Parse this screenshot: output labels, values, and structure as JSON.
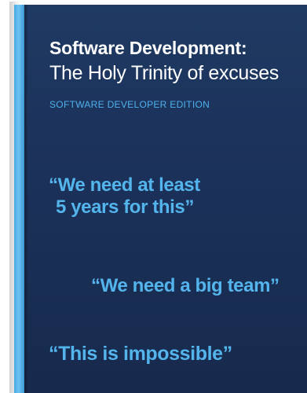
{
  "cover": {
    "title": "Software Development:",
    "subtitle": "The Holy Trinity of excuses",
    "edition": "SOFTWARE DEVELOPER EDITION",
    "quotes": [
      {
        "line1": "“We need at least",
        "line2": "5 years for this”"
      },
      {
        "line1": "“We need a big team”"
      },
      {
        "line1": "“This is impossible”"
      }
    ]
  },
  "colors": {
    "cover_background": "#1b3159",
    "spine": "#5ab6ec",
    "accent_text": "#54b4ec",
    "title_text": "#ffffff"
  }
}
